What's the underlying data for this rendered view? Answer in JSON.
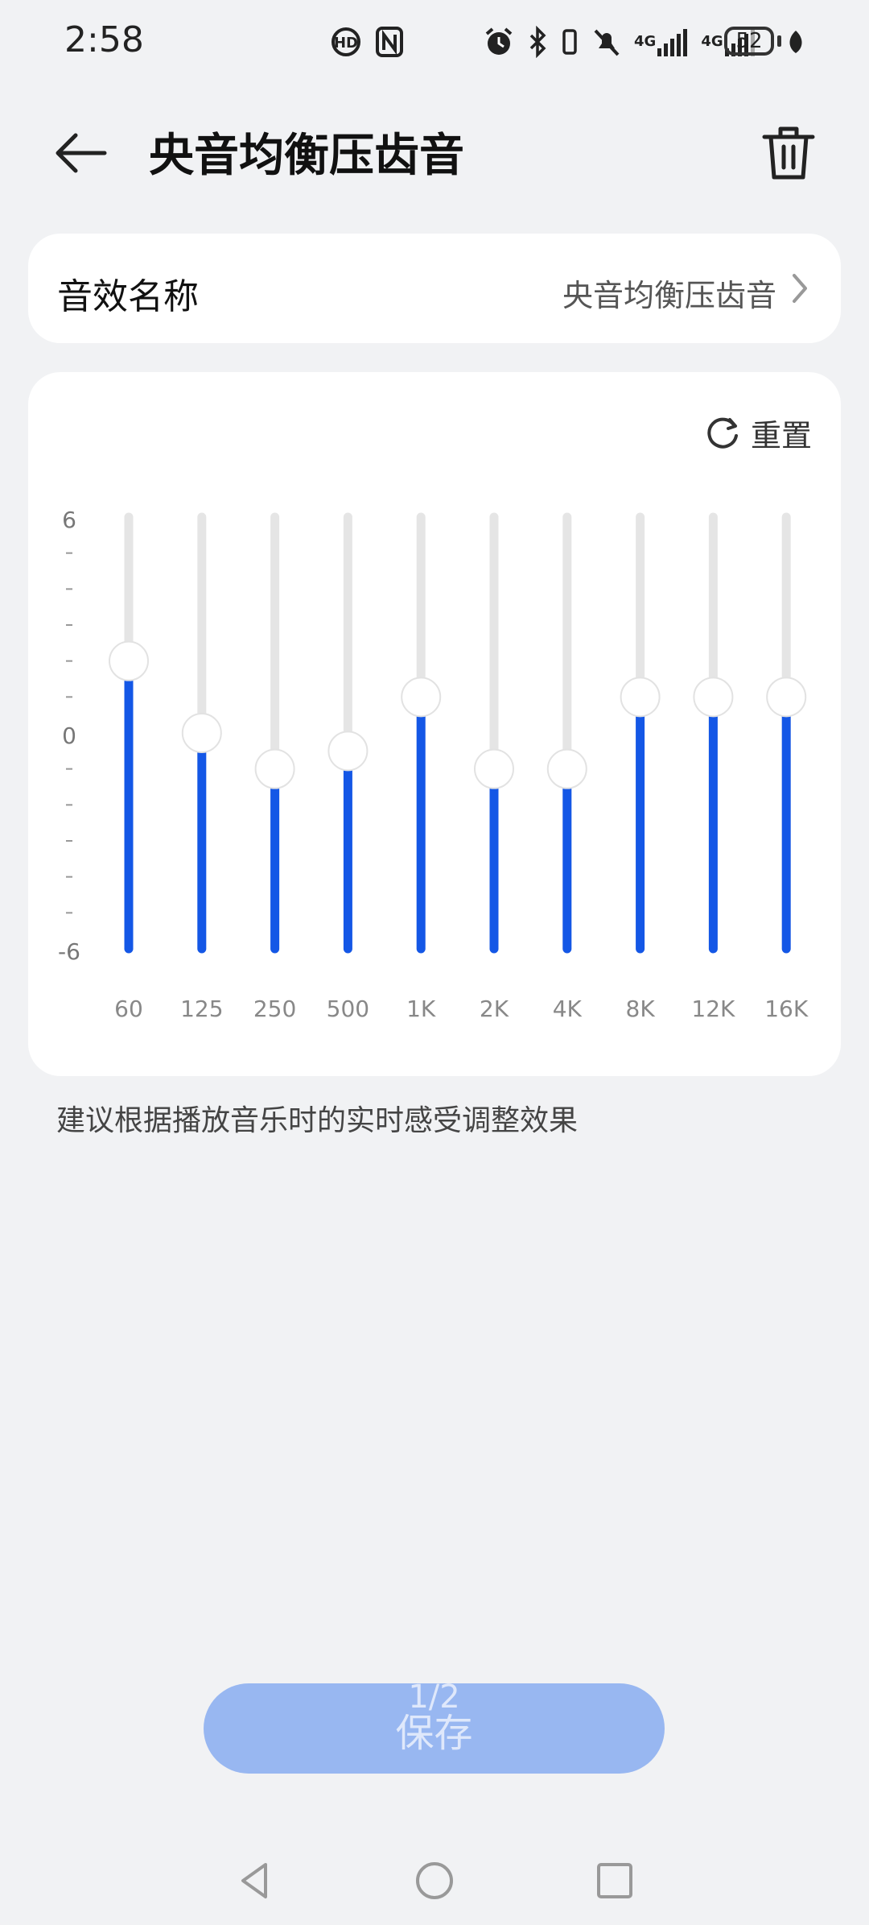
{
  "status_bar": {
    "time": "2:58",
    "signal_1_label": "4G",
    "signal_2_label": "4G",
    "battery_level": "52",
    "icons": [
      "hd-voice-icon",
      "nfc-icon",
      "alarm-icon",
      "bluetooth-icon",
      "vibrate-icon",
      "mute-icon",
      "signal-icon",
      "signal-icon",
      "battery-icon",
      "leaf-icon"
    ]
  },
  "header": {
    "title": "央音均衡压齿音",
    "back_icon": "back-arrow-icon",
    "delete_icon": "trash-icon"
  },
  "sound_name": {
    "label": "音效名称",
    "value": "央音均衡压齿音"
  },
  "equalizer": {
    "reset_label": "重置",
    "y_max_label": "6",
    "y_mid_label": "0",
    "y_min_label": "-6",
    "ylim": [
      -6,
      6
    ],
    "bands": [
      {
        "freq": "60",
        "gain": 2
      },
      {
        "freq": "125",
        "gain": 0
      },
      {
        "freq": "250",
        "gain": -1
      },
      {
        "freq": "500",
        "gain": -0.5
      },
      {
        "freq": "1K",
        "gain": 1
      },
      {
        "freq": "2K",
        "gain": -1
      },
      {
        "freq": "4K",
        "gain": -1
      },
      {
        "freq": "8K",
        "gain": 1
      },
      {
        "freq": "12K",
        "gain": 1
      },
      {
        "freq": "16K",
        "gain": 1
      }
    ]
  },
  "hint": "建议根据播放音乐时的实时感受调整效果",
  "save": {
    "label": "保存",
    "page_indicator": "1/2"
  },
  "colors": {
    "accent": "#1457e6",
    "track": "#e5e5e5",
    "save_button": "#98b7f1",
    "background": "#f1f2f4"
  }
}
